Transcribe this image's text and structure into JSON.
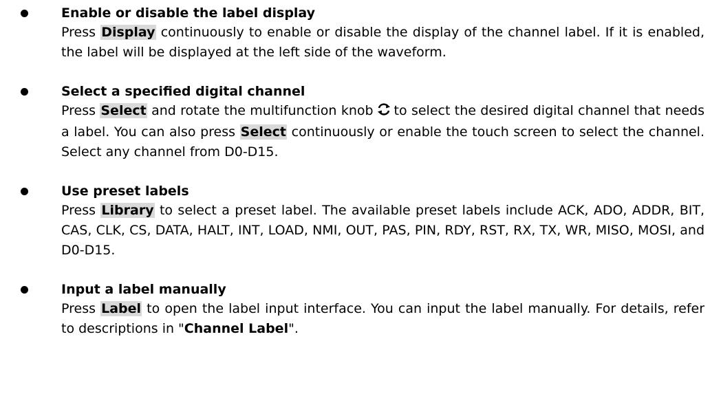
{
  "items": [
    {
      "title": "Enable or disable the label display",
      "key": "Display",
      "press": "Press",
      "text_after_key": "continuously to enable or disable the display of the channel label. If it is enabled, the label will be displayed at the left side of the waveform."
    },
    {
      "title": "Select a specified digital channel",
      "press": "Press",
      "key": "Select",
      "text_before_knob": "and rotate the multifunction knob",
      "knob_icon": "multifunction-knob-icon",
      "text_after_knob": "to select the desired digital channel that needs a label. You can also press",
      "key2": "Select",
      "text_after_key2": "continuously or enable the touch screen to select the channel. Select any channel from D0-D15."
    },
    {
      "title": "Use preset labels",
      "press": "Press",
      "key": "Library",
      "text_after_key": "to select a preset label. The available preset labels include ACK, ADO, ADDR, BIT, CAS, CLK, CS, DATA, HALT, INT, LOAD, NMI, OUT, PAS, PIN, RDY, RST, RX, TX, WR, MISO, MOSI, and D0-D15."
    },
    {
      "title": "Input a label manually",
      "press": "Press",
      "key": "Label",
      "text_after_key": "to open the label input interface. You can input the label manually. For details, refer to descriptions in \"",
      "ref": "Channel Label",
      "text_end": "\"."
    }
  ]
}
